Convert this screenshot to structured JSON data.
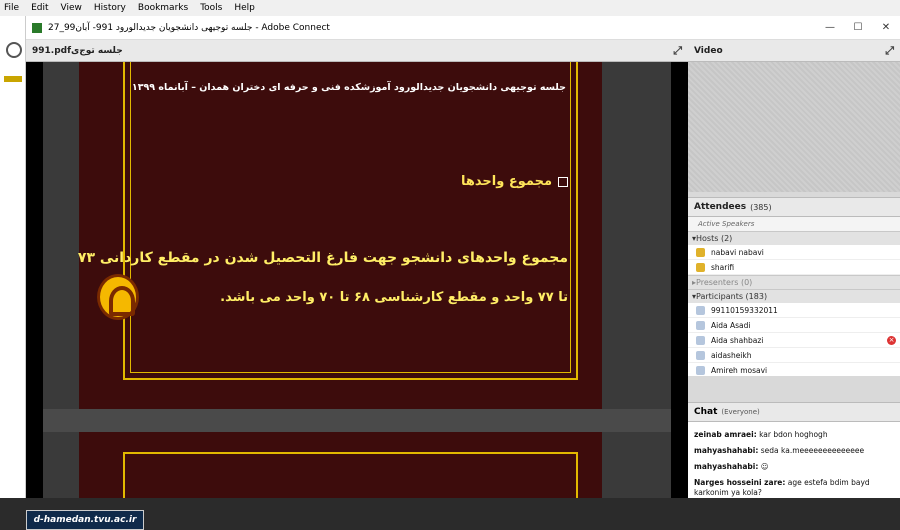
{
  "menu": [
    "File",
    "Edit",
    "View",
    "History",
    "Bookmarks",
    "Tools",
    "Help"
  ],
  "window": {
    "title": "جلسه توجیهی دانشجویان جدیدالورود 991- آبان99_27 - Adobe Connect"
  },
  "share_pod": {
    "title": "991.pdfجلسه توج‌ی",
    "slide": {
      "heading": "جلسه توجیهی دانشجویان جدیدالورود آموزشکده فنی و حرفه ای دختران همدان – آبانماه ۱۳۹۹",
      "bullet": "مجموع واحدها",
      "line1": "مجموع واحدهای دانشجو جهت فارغ التحصیل شدن در مقطع کاردانی ۷۳",
      "line2": "تا ۷۷ واحد و مقطع کارشناسی ۶۸ تا ۷۰ واحد می باشد."
    }
  },
  "video_pod": {
    "title": "Video"
  },
  "attendees": {
    "title": "Attendees",
    "count": "(385)",
    "active_speakers": "Active Speakers",
    "hosts_label": "Hosts (2)",
    "hosts": [
      "nabavi nabavi",
      "sharifi"
    ],
    "presenters_label": "Presenters (0)",
    "participants_label": "Participants (183)",
    "participants": [
      "99110159332011",
      "Aida Asadi",
      "Aida shahbazi",
      "aidasheikh",
      "Amireh mosavi"
    ]
  },
  "chat": {
    "title": "Chat",
    "scope": "(Everyone)",
    "messages": [
      {
        "sender": "zeinab amraei:",
        "text": " kar bdon hoghogh"
      },
      {
        "sender": "mahyashahabi:",
        "text": "  seda ka.meeeeeeeeeeeeee"
      },
      {
        "sender": "mahyashahabi:",
        "text": " ☺"
      },
      {
        "sender": "Narges hosseini zare:",
        "text": " age estefa bdim bayd karkonim ya kola?"
      }
    ]
  },
  "watermark": "d-hamedan.tvu.ac.ir"
}
